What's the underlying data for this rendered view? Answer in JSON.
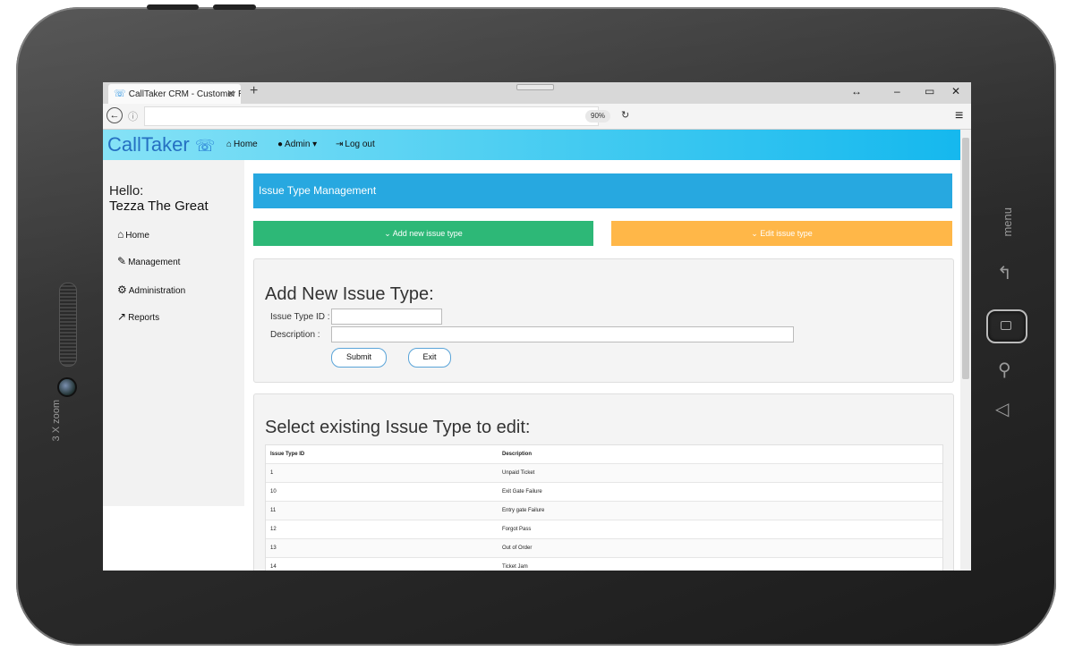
{
  "device": {
    "zoom_label": "3 X zoom",
    "menu_label": "menu"
  },
  "browser": {
    "tab_title": "CallTaker CRM - Customer R",
    "tab_close": "✕",
    "new_tab": "+",
    "zoom": "90%",
    "window_controls": [
      "↔",
      "–",
      "▭",
      "✕"
    ]
  },
  "navbar": {
    "brand": "CallTaker",
    "home": "Home",
    "admin": "Admin ▾",
    "logout": "Log out"
  },
  "sidebar": {
    "greeting": "Hello:",
    "username": "Tezza The Great",
    "items": [
      {
        "label": "Home",
        "icon": "home-icon"
      },
      {
        "label": "Management",
        "icon": "wrench-icon"
      },
      {
        "label": "Administration",
        "icon": "cog-icon"
      },
      {
        "label": "Reports",
        "icon": "chart-icon"
      }
    ]
  },
  "main": {
    "panel_title": "Issue Type Management",
    "add_button": "Add new issue type",
    "edit_button": "Edit issue type",
    "add_form": {
      "heading": "Add New Issue Type:",
      "id_label": "Issue Type ID :",
      "id_value": "",
      "desc_label": "Description :",
      "desc_value": "",
      "submit": "Submit",
      "exit": "Exit"
    },
    "edit_list": {
      "heading": "Select existing Issue Type to edit:",
      "columns": [
        "Issue Type ID",
        "Description"
      ],
      "rows": [
        [
          "1",
          "Unpaid Ticket"
        ],
        [
          "10",
          "Exit Gate Failure"
        ],
        [
          "11",
          "Entry gate Failure"
        ],
        [
          "12",
          "Forgot Pass"
        ],
        [
          "13",
          "Out of Order"
        ],
        [
          "14",
          "Ticket Jam"
        ]
      ]
    }
  },
  "colors": {
    "panel_blue": "#27a8e0",
    "add_green": "#2db877",
    "edit_orange": "#ffb748",
    "brand_blue": "#2570c2"
  }
}
